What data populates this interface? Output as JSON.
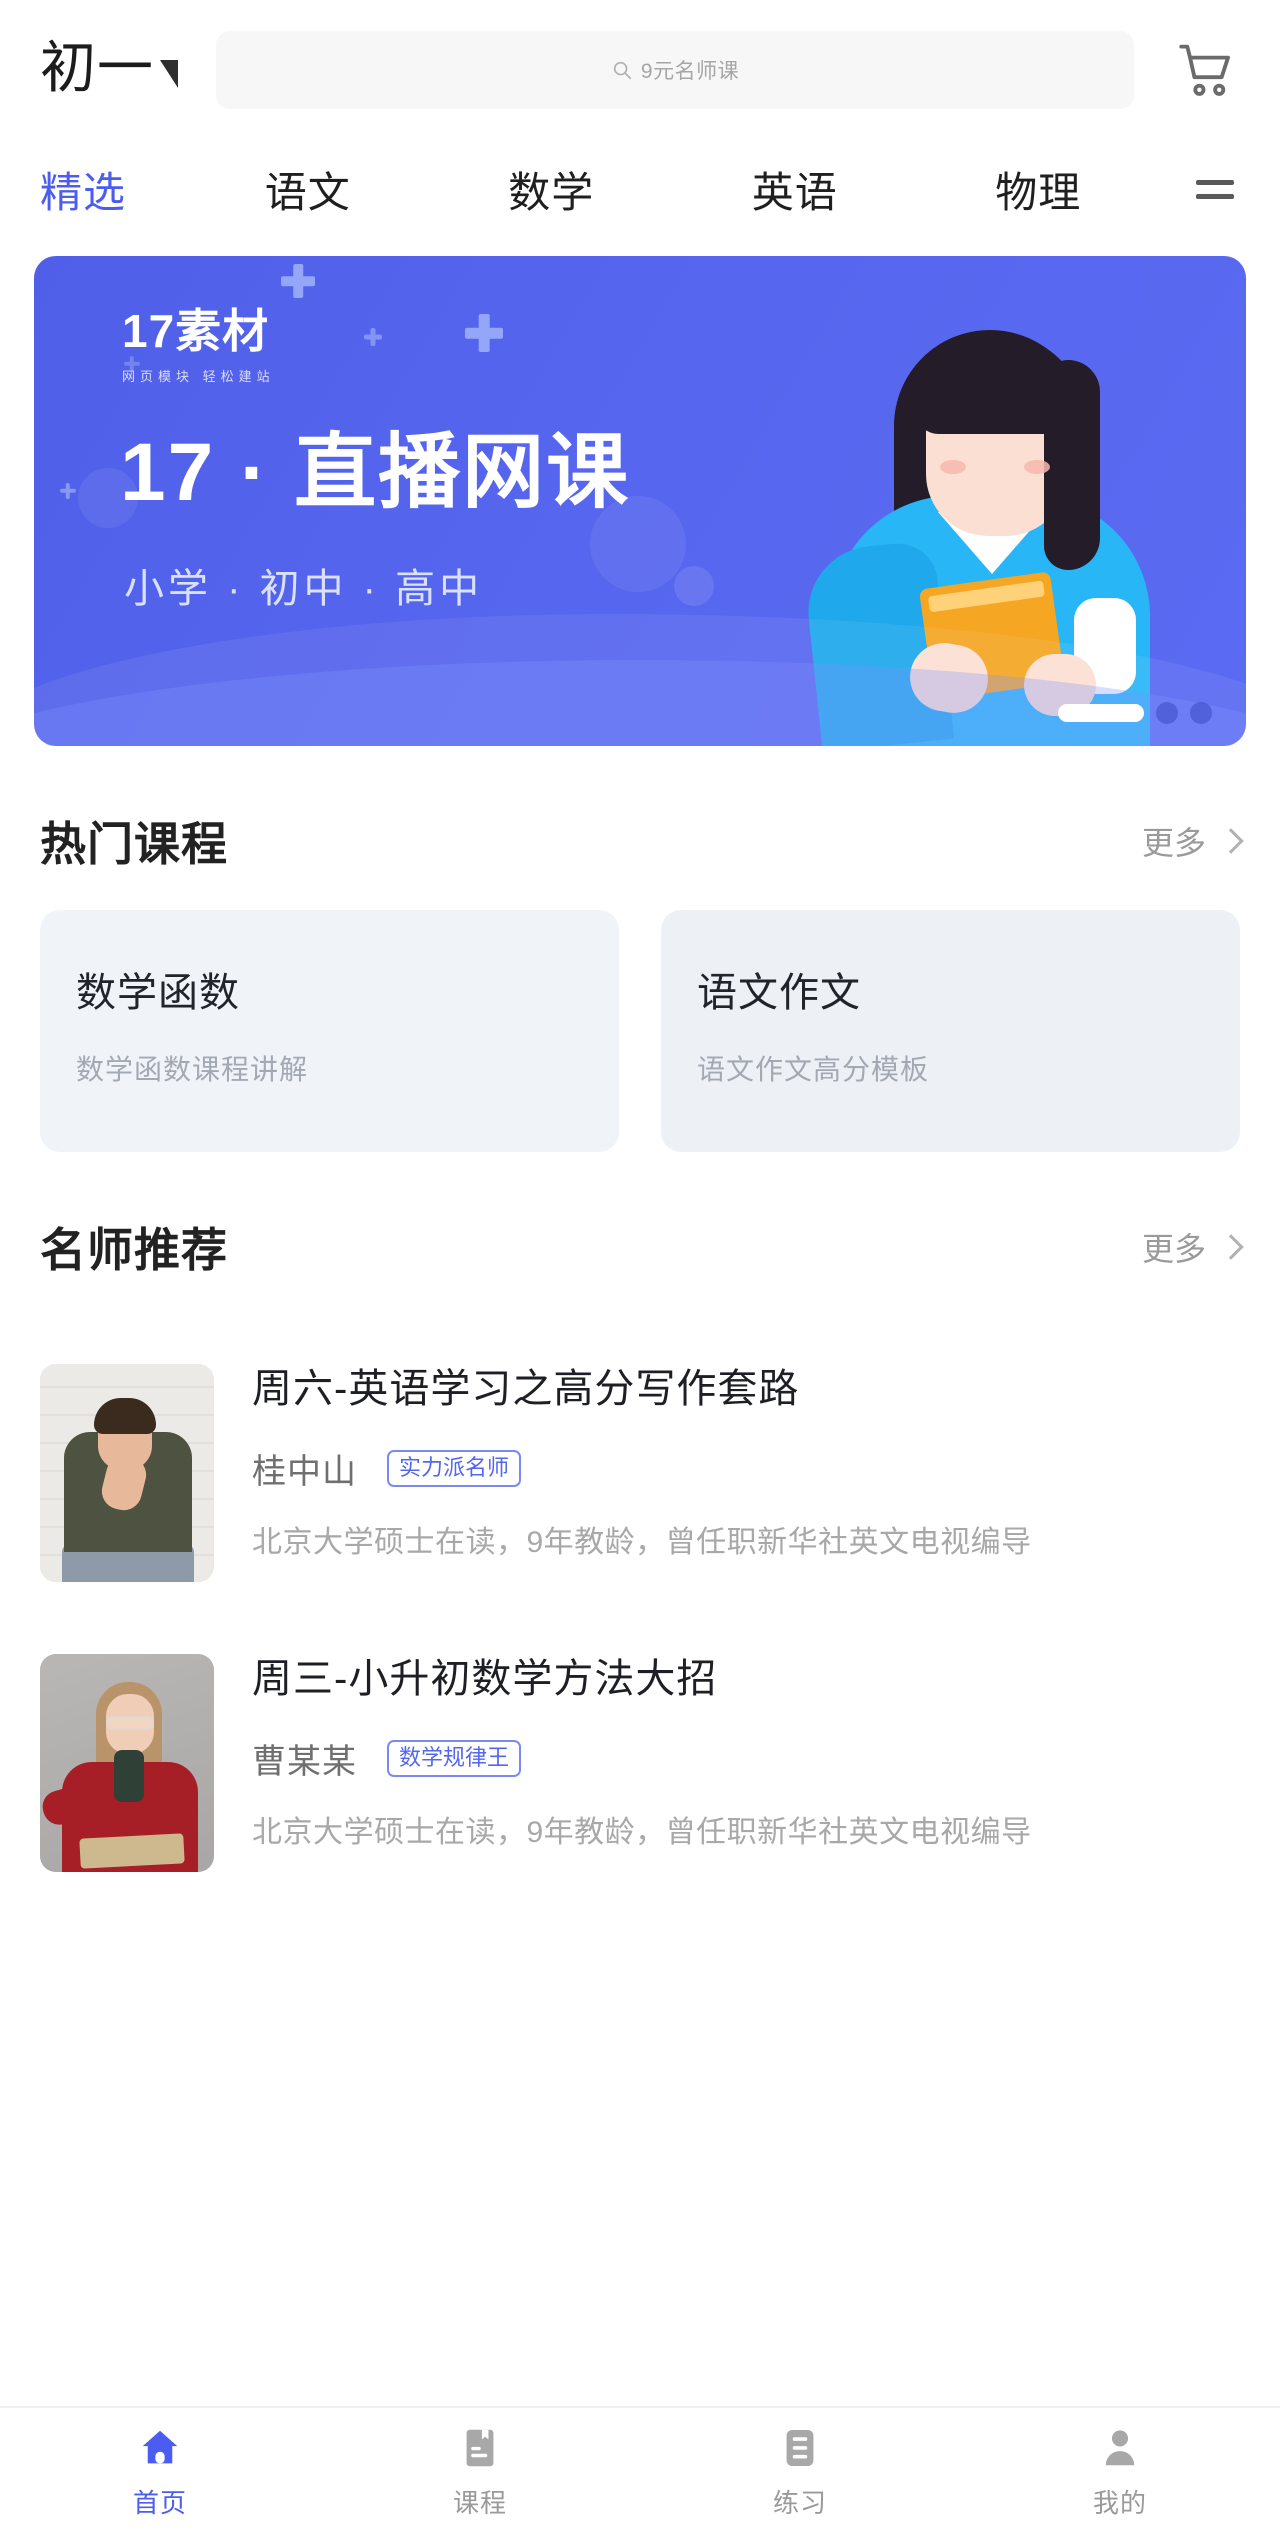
{
  "header": {
    "grade_label": "初一",
    "grade_caret_icon": "triangle-down-icon",
    "search": {
      "icon": "search-icon",
      "placeholder": "9元名师课",
      "value": ""
    },
    "cart_icon": "shopping-cart-icon"
  },
  "category_tabs": {
    "items": [
      {
        "label": "精选",
        "active": true
      },
      {
        "label": "语文",
        "active": false
      },
      {
        "label": "数学",
        "active": false
      },
      {
        "label": "英语",
        "active": false
      },
      {
        "label": "物理",
        "active": false
      }
    ],
    "more_icon": "hamburger-menu-icon",
    "active_color": "#4a5df0"
  },
  "banner": {
    "logo_main": "17素材",
    "logo_sub": "网页模块  轻松建站",
    "title": "17 · 直播网课",
    "subtitle": "小学 · 初中 · 高中",
    "background_color": "#5666ee",
    "pagination": {
      "total": 3,
      "active_index": 0
    }
  },
  "hot_courses": {
    "title": "热门课程",
    "more_label": "更多",
    "more_icon": "chevron-right-icon",
    "cards": [
      {
        "title": "数学函数",
        "desc": "数学函数课程讲解"
      },
      {
        "title": "语文作文",
        "desc": "语文作文高分模板"
      }
    ]
  },
  "teacher_recommend": {
    "title": "名师推荐",
    "more_label": "更多",
    "more_icon": "chevron-right-icon",
    "teachers": [
      {
        "course_title": "周六-英语学习之高分写作套路",
        "name": "桂中山",
        "badge": "实力派名师",
        "desc": "北京大学硕士在读，9年教龄，曾任职新华社英文电视编导",
        "avatar_alt": "male-teacher-photo"
      },
      {
        "course_title": "周三-小升初数学方法大招",
        "name": "曹某某",
        "badge": "数学规律王",
        "desc": "北京大学硕士在读，9年教龄，曾任职新华社英文电视编导",
        "avatar_alt": "female-teacher-photo"
      }
    ],
    "badge_color": "#5566ee"
  },
  "bottom_nav": {
    "items": [
      {
        "label": "首页",
        "icon": "home-icon",
        "active": true
      },
      {
        "label": "课程",
        "icon": "book-icon",
        "active": false
      },
      {
        "label": "练习",
        "icon": "list-icon",
        "active": false
      },
      {
        "label": "我的",
        "icon": "person-icon",
        "active": false
      }
    ],
    "active_color": "#4a5df0",
    "inactive_color": "#9a9a9a"
  }
}
